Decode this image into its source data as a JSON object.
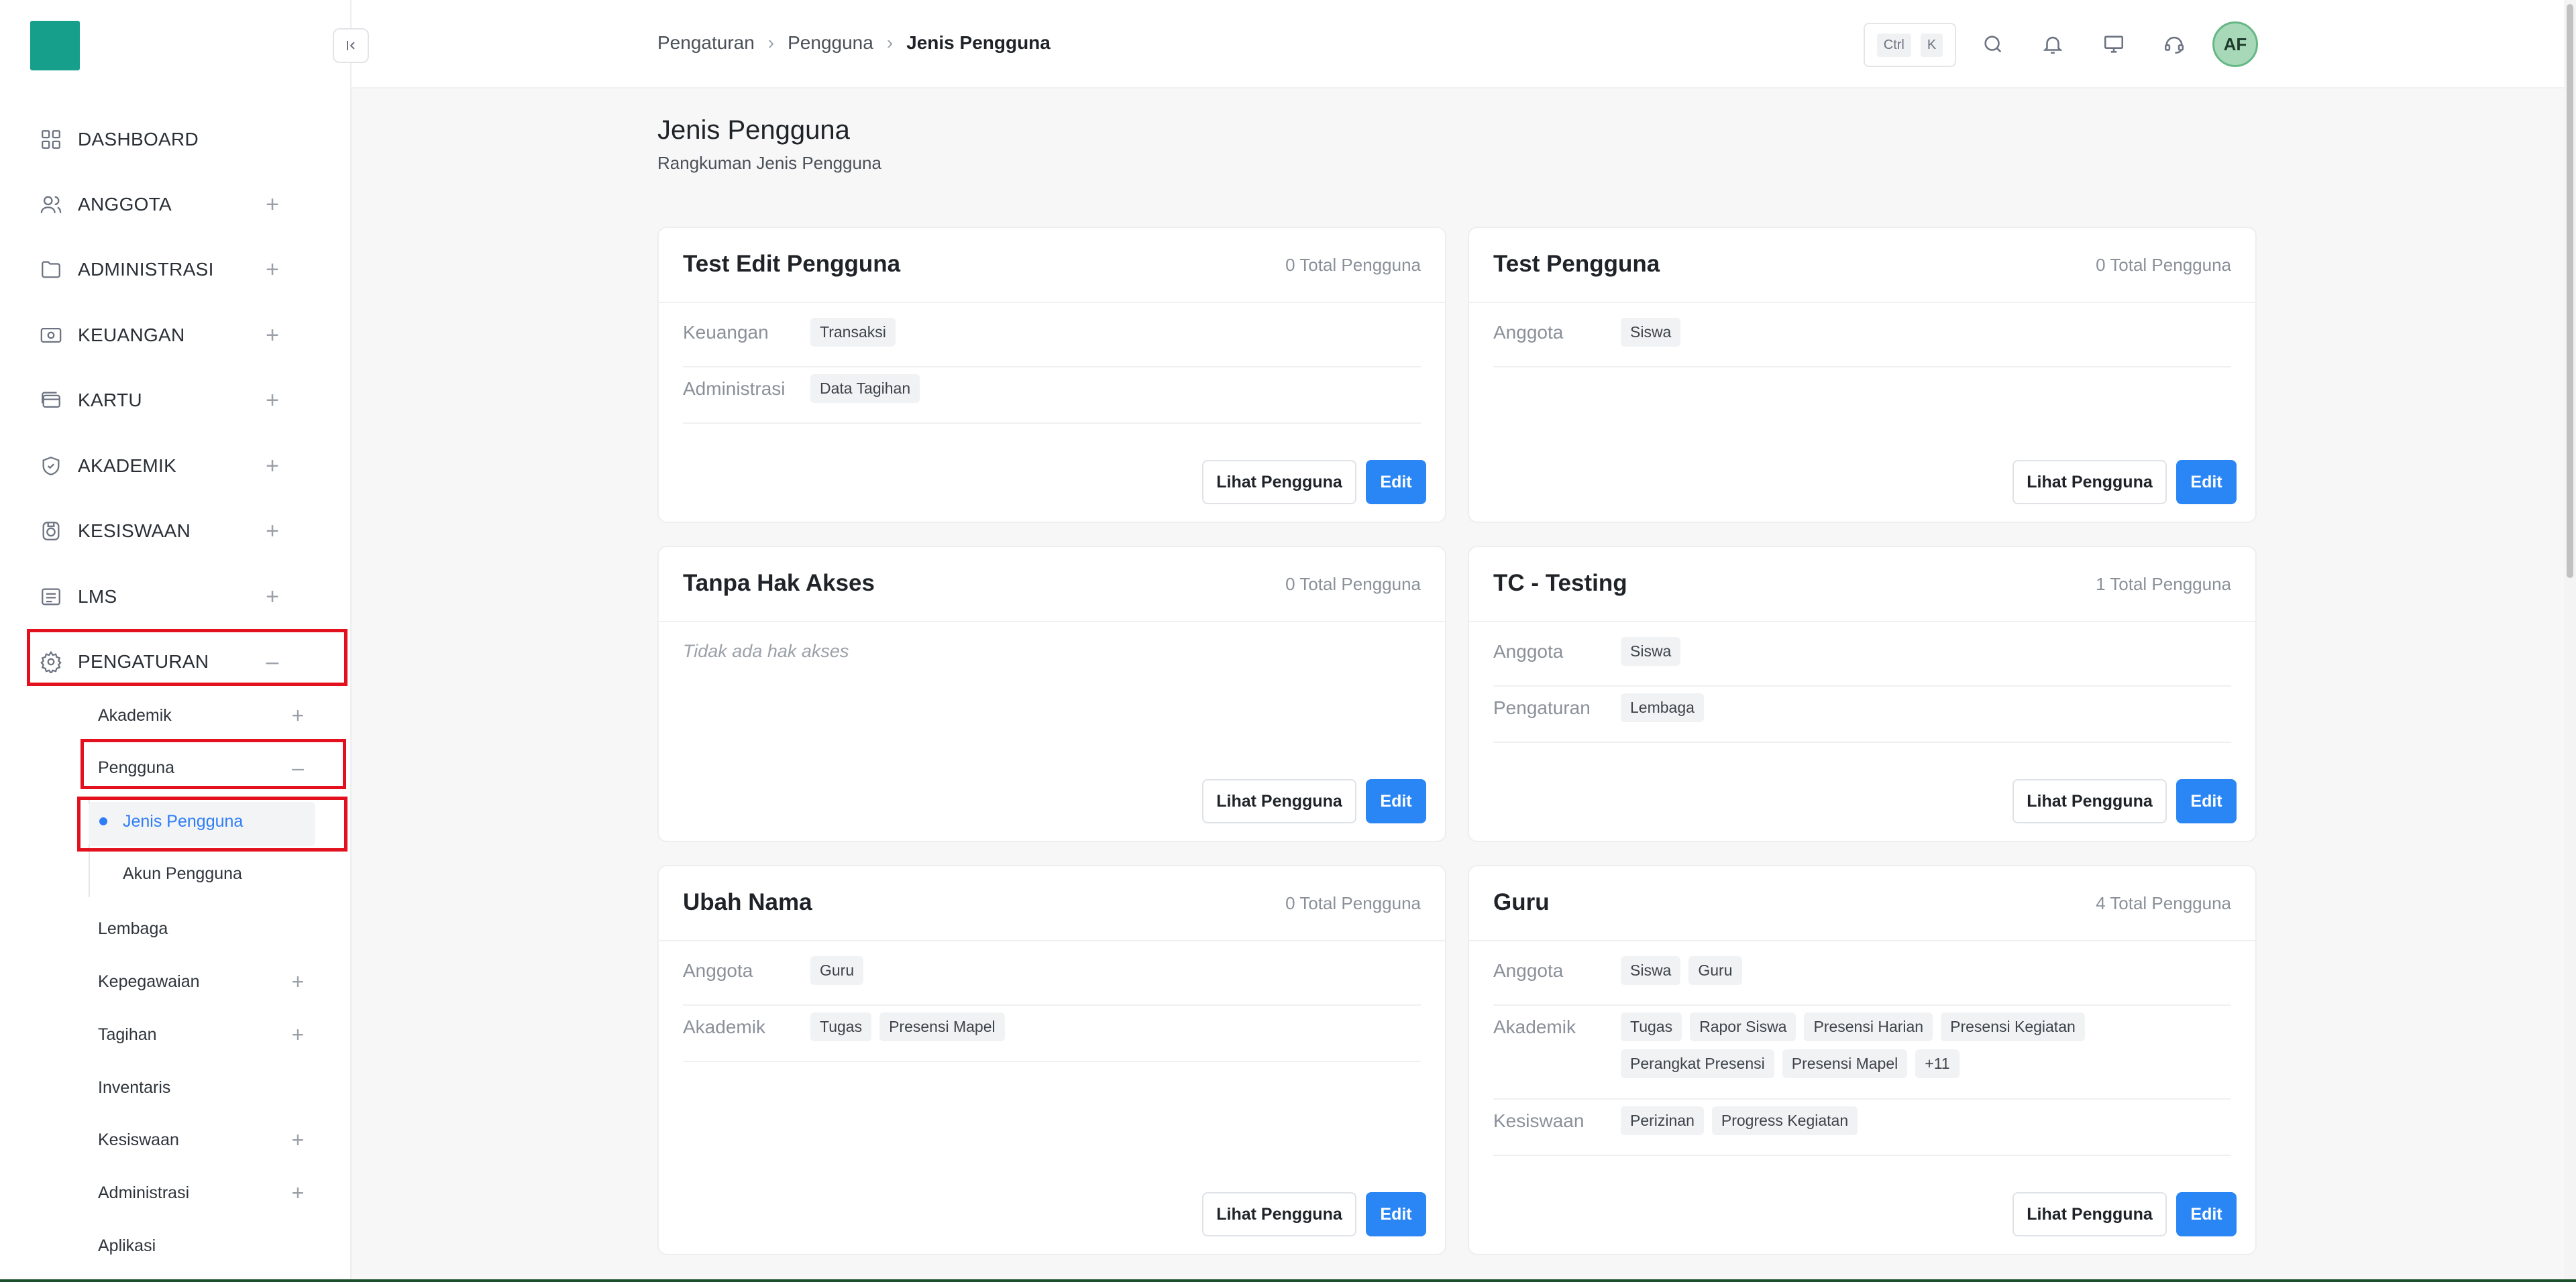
{
  "sidebar": {
    "items": [
      {
        "label": "DASHBOARD",
        "icon": "grid-icon"
      },
      {
        "label": "ANGGOTA",
        "icon": "users-icon"
      },
      {
        "label": "ADMINISTRASI",
        "icon": "folder-icon"
      },
      {
        "label": "KEUANGAN",
        "icon": "banknote-icon"
      },
      {
        "label": "KARTU",
        "icon": "cards-icon"
      },
      {
        "label": "AKADEMIK",
        "icon": "badge-icon"
      },
      {
        "label": "KESISWAAN",
        "icon": "medal-icon"
      },
      {
        "label": "LMS",
        "icon": "list-icon"
      },
      {
        "label": "PENGATURAN",
        "icon": "gear-icon"
      }
    ],
    "sub_items": [
      {
        "label": "Akademik"
      },
      {
        "label": "Pengguna"
      },
      {
        "label": "Jenis Pengguna"
      },
      {
        "label": "Akun Pengguna"
      },
      {
        "label": "Lembaga"
      },
      {
        "label": "Kepegawaian"
      },
      {
        "label": "Tagihan"
      },
      {
        "label": "Inventaris"
      },
      {
        "label": "Kesiswaan"
      },
      {
        "label": "Administrasi"
      },
      {
        "label": "Aplikasi"
      }
    ]
  },
  "header": {
    "breadcrumb": [
      "Pengaturan",
      "Pengguna",
      "Jenis Pengguna"
    ],
    "shortcut": [
      "Ctrl",
      "K"
    ],
    "avatar": "AF"
  },
  "main": {
    "title": "Jenis Pengguna",
    "subtitle": "Rangkuman Jenis Pengguna",
    "view_label": "Lihat Pengguna",
    "edit_label": "Edit",
    "no_access": "Tidak ada hak akses",
    "cards": [
      {
        "title": "Test Edit Pengguna",
        "count": "0 Total Pengguna",
        "perms": [
          {
            "label": "Keuangan",
            "chips": [
              "Transaksi"
            ]
          },
          {
            "label": "Administrasi",
            "chips": [
              "Data Tagihan"
            ]
          }
        ]
      },
      {
        "title": "Test Pengguna",
        "count": "0 Total Pengguna",
        "perms": [
          {
            "label": "Anggota",
            "chips": [
              "Siswa"
            ]
          }
        ]
      },
      {
        "title": "Tanpa Hak Akses",
        "count": "0 Total Pengguna",
        "perms": []
      },
      {
        "title": "TC - Testing",
        "count": "1 Total Pengguna",
        "perms": [
          {
            "label": "Anggota",
            "chips": [
              "Siswa"
            ]
          },
          {
            "label": "Pengaturan",
            "chips": [
              "Lembaga"
            ]
          }
        ]
      },
      {
        "title": "Ubah Nama",
        "count": "0 Total Pengguna",
        "perms": [
          {
            "label": "Anggota",
            "chips": [
              "Guru"
            ]
          },
          {
            "label": "Akademik",
            "chips": [
              "Tugas",
              "Presensi Mapel"
            ]
          }
        ]
      },
      {
        "title": "Guru",
        "count": "4 Total Pengguna",
        "perms": [
          {
            "label": "Anggota",
            "chips": [
              "Siswa",
              "Guru"
            ]
          },
          {
            "label": "Akademik",
            "chips": [
              "Tugas",
              "Rapor Siswa",
              "Presensi Harian",
              "Presensi Kegiatan",
              "Perangkat Presensi",
              "Presensi Mapel",
              "+11"
            ]
          },
          {
            "label": "Kesiswaan",
            "chips": [
              "Perizinan",
              "Progress Kegiatan"
            ]
          }
        ]
      }
    ]
  },
  "colors": {
    "accent": "#2b86f5",
    "logo": "#16a08c",
    "highlight": "#e3101e"
  }
}
